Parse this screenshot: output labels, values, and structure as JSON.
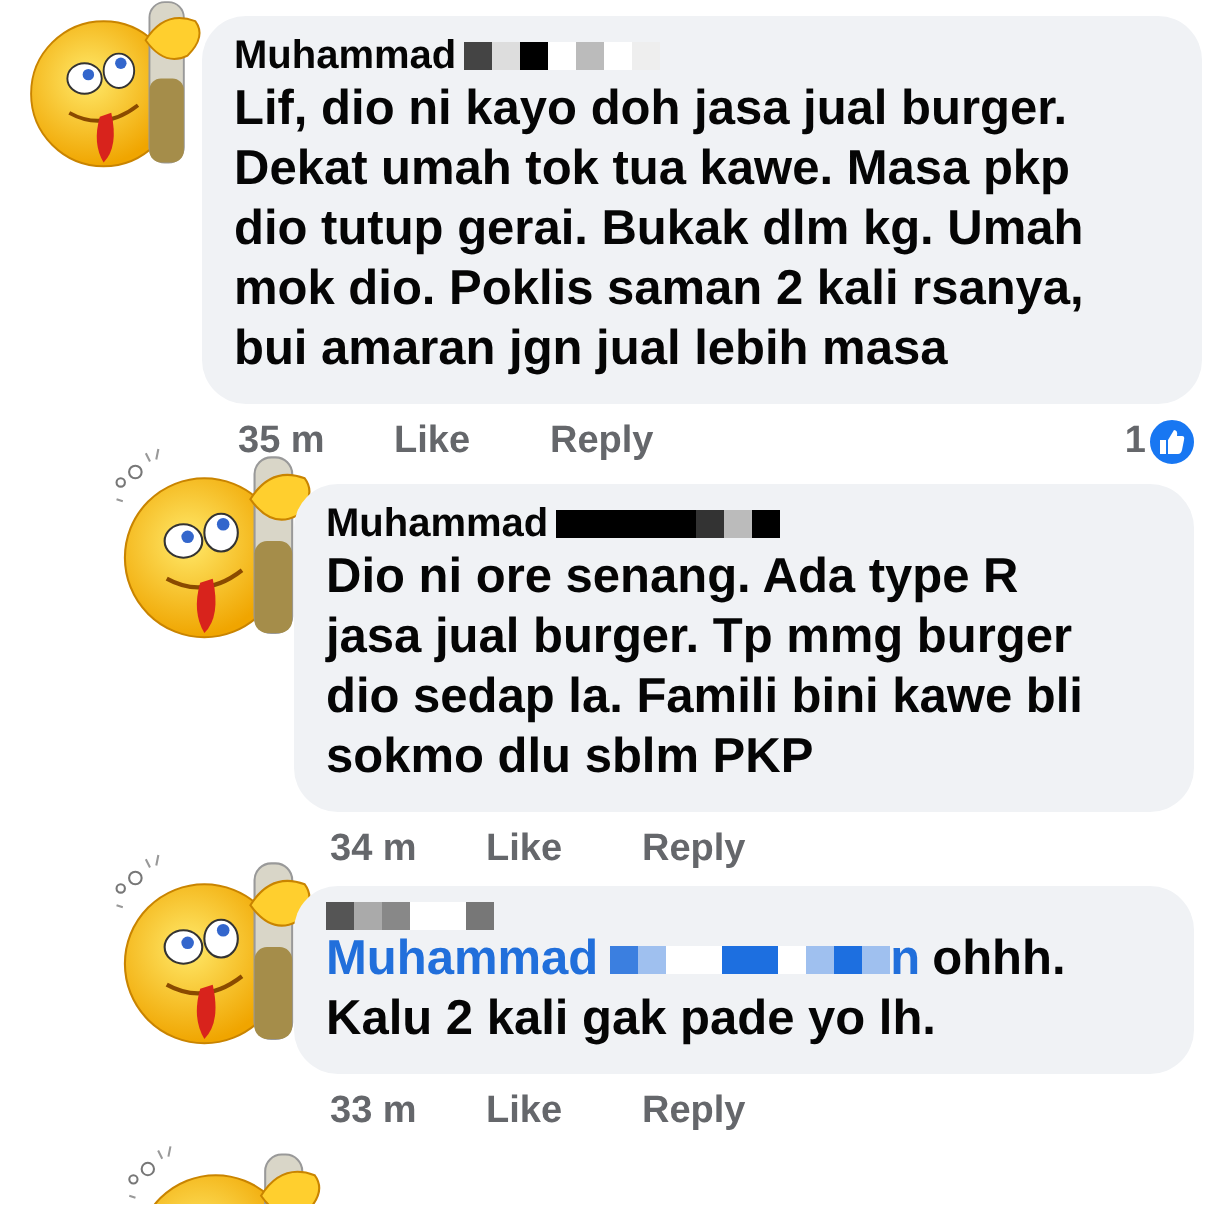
{
  "comments": [
    {
      "kind": "comment",
      "author": "Muhammad",
      "lines": [
        "Lif, dio ni kayo doh jasa jual burger.",
        "Dekat umah tok tua kawe. Masa pkp",
        "dio tutup gerai. Bukak dlm kg. Umah",
        "mok dio. Poklis saman 2 kali rsanya,",
        "bui amaran jgn jual lebih masa"
      ],
      "time": "35 m",
      "like": "Like",
      "reply": "Reply",
      "reaction_count": "1"
    },
    {
      "kind": "reply",
      "author": "Muhammad",
      "lines": [
        "Dio ni ore senang. Ada type R",
        "jasa jual burger. Tp mmg burger",
        "dio sedap la. Famili bini kawe bli",
        "sokmo dlu sblm PKP"
      ],
      "time": "34 m",
      "like": "Like",
      "reply": "Reply"
    },
    {
      "kind": "reply",
      "mention_start": "Muhammad",
      "mention_end": "n",
      "lines": [
        "ohhh.",
        "Kalu 2 kali gak pade yo lh."
      ],
      "time": "33 m",
      "like": "Like",
      "reply": "Reply"
    }
  ],
  "more_below": true
}
